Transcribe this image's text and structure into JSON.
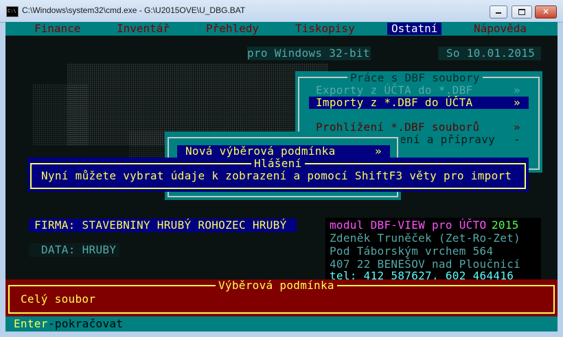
{
  "window": {
    "title": "C:\\Windows\\system32\\cmd.exe - G:\\U2015OVE\\U_DBG.BAT"
  },
  "menu": {
    "items": [
      {
        "label": "Finance"
      },
      {
        "label": "Inventář"
      },
      {
        "label": "Přehledy"
      },
      {
        "label": "Tiskopisy"
      },
      {
        "label": "Ostatní"
      },
      {
        "label": "Nápověda"
      }
    ],
    "active_index": 4
  },
  "header": {
    "platform": "pro Windows 32-bit",
    "date": "So 10.01.2015"
  },
  "dbf_menu": {
    "title": "Práce s DBF soubory",
    "items": [
      {
        "label": "Exporty z ÚČTA do *.DBF",
        "arrow": "»",
        "state": "disabled"
      },
      {
        "label": "Importy z *.DBF do ÚČTA",
        "arrow": "»",
        "state": "selected"
      },
      {
        "label": "Prohlížení *.DBF souborů",
        "arrow": "»",
        "state": "normal"
      },
      {
        "label": "ení a přípravy",
        "arrow": "-",
        "state": "partial"
      }
    ]
  },
  "condition_menu": {
    "item_label": "Nová výběrová podmínka",
    "arrow": "»"
  },
  "message_dialog": {
    "title": "Hlášení",
    "text": "Nyní můžete vybrat údaje k zobrazení a pomocí ShiftF3 věty pro import"
  },
  "company": {
    "firma": "FIRMA: STAVEBNINY HRUBÝ ROHOZEC HRUBÝ",
    "data": "DATA: HRUBY"
  },
  "module_info": {
    "line1_prefix": "modul DBF-VIEW pro ÚČTO",
    "line1_year": "2015",
    "author": "Zdeněk Truněček (Zet-Ro-Zet)",
    "street": "Pod Táborským vrchem 564",
    "city": "407 22 BENEŠOV nad Ploučnicí",
    "phone": "tel: 412 587627, 602 464416"
  },
  "selection_panel": {
    "title": "Výběrová podmínka",
    "value": "Celý soubor"
  },
  "status": {
    "key": "Enter",
    "action": "-pokračovat"
  },
  "colors": {
    "console_teal": "#008080",
    "console_navy": "#000080",
    "console_maroon": "#800000",
    "highlight_yellow": "#ffff55",
    "magenta": "#ff55ff",
    "cyan": "#55ffff"
  }
}
